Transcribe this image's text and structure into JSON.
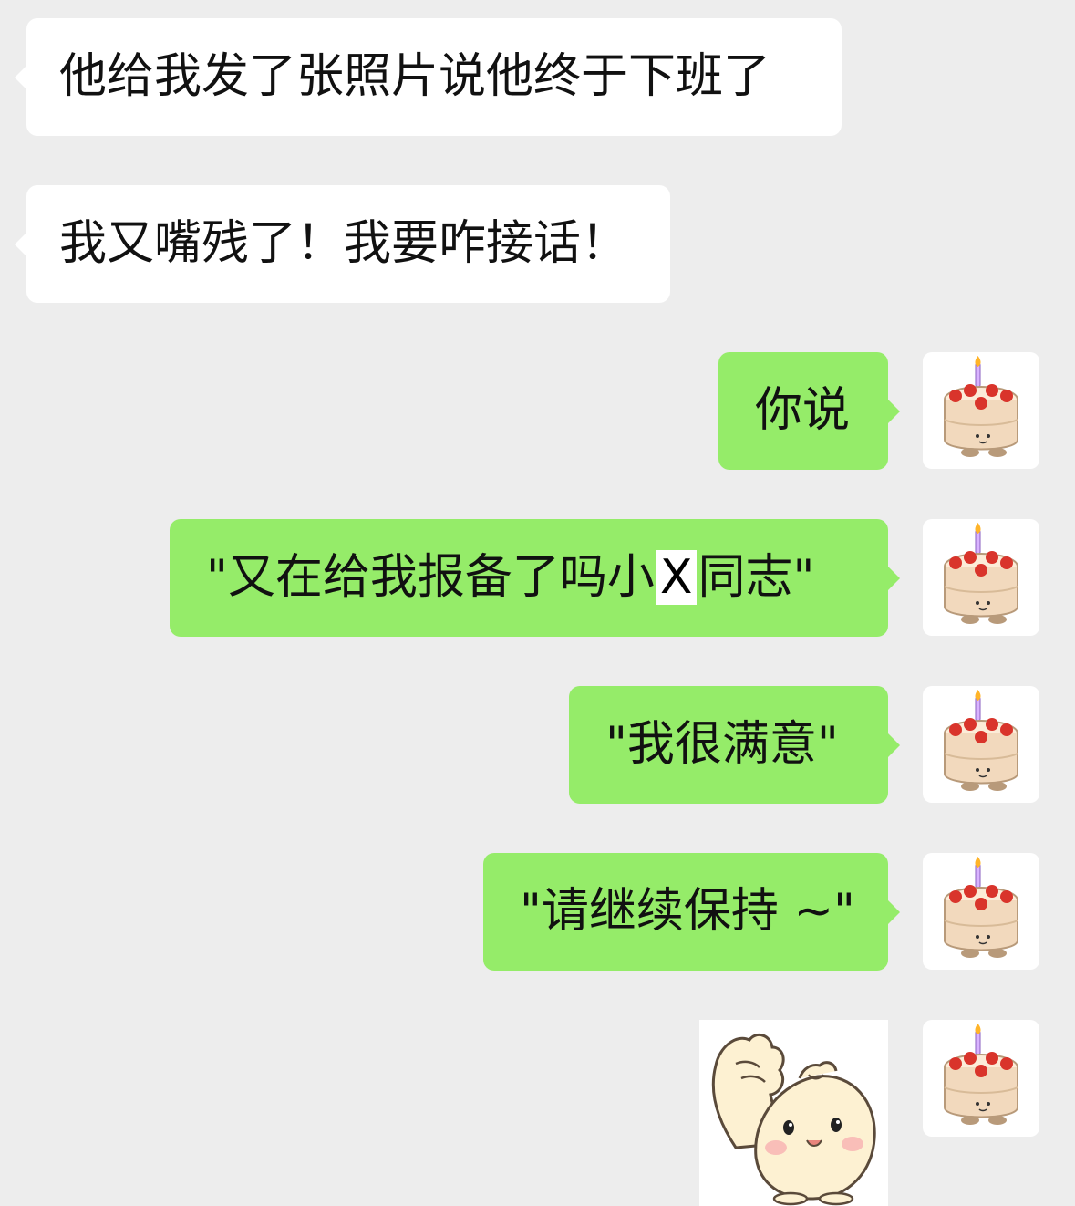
{
  "chat": {
    "messages": [
      {
        "side": "left",
        "text": "他给我发了张照片说他终于下班了"
      },
      {
        "side": "left",
        "text": "我又嘴残了！我要咋接话！"
      },
      {
        "side": "right",
        "text": "你说"
      },
      {
        "side": "right",
        "text_before": "\"又在给我报备了吗小",
        "censored": "X",
        "text_after": "同志\""
      },
      {
        "side": "right",
        "text": "\"我很满意\""
      },
      {
        "side": "right",
        "text": "\"请继续保持 ~\""
      },
      {
        "side": "right",
        "sticker": "dumpling-thumbs-up-sticker"
      }
    ],
    "avatar_icon": "birthday-cake-avatar"
  },
  "colors": {
    "background": "#ededed",
    "incoming_bubble": "#ffffff",
    "outgoing_bubble": "#95ec69",
    "text": "#111111"
  }
}
